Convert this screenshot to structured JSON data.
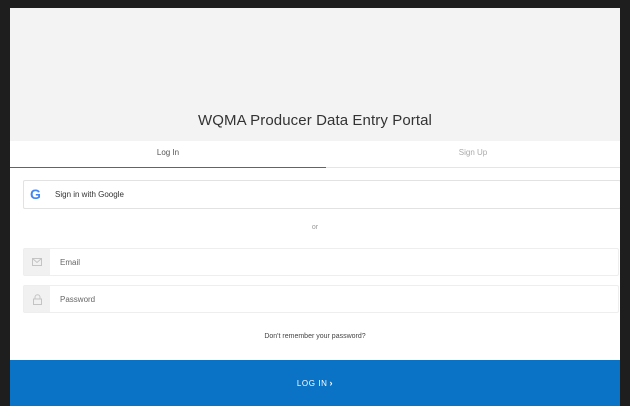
{
  "portal": {
    "title": "WQMA Producer Data Entry Portal"
  },
  "tabs": {
    "login": "Log In",
    "signup": "Sign Up"
  },
  "google": {
    "label": "Sign in with Google",
    "icon": "google-icon"
  },
  "separator": "or",
  "email": {
    "placeholder": "Email",
    "value": "",
    "icon": "envelope-icon"
  },
  "password": {
    "placeholder": "Password",
    "value": "",
    "icon": "lock-icon"
  },
  "forgot_password": "Don't remember your password?",
  "submit": {
    "label": "LOG IN",
    "icon": "chevron-right-icon"
  },
  "colors": {
    "accent": "#0a73c6",
    "header_bg": "#f3f3f3",
    "page_bg": "#1e1e1e"
  }
}
